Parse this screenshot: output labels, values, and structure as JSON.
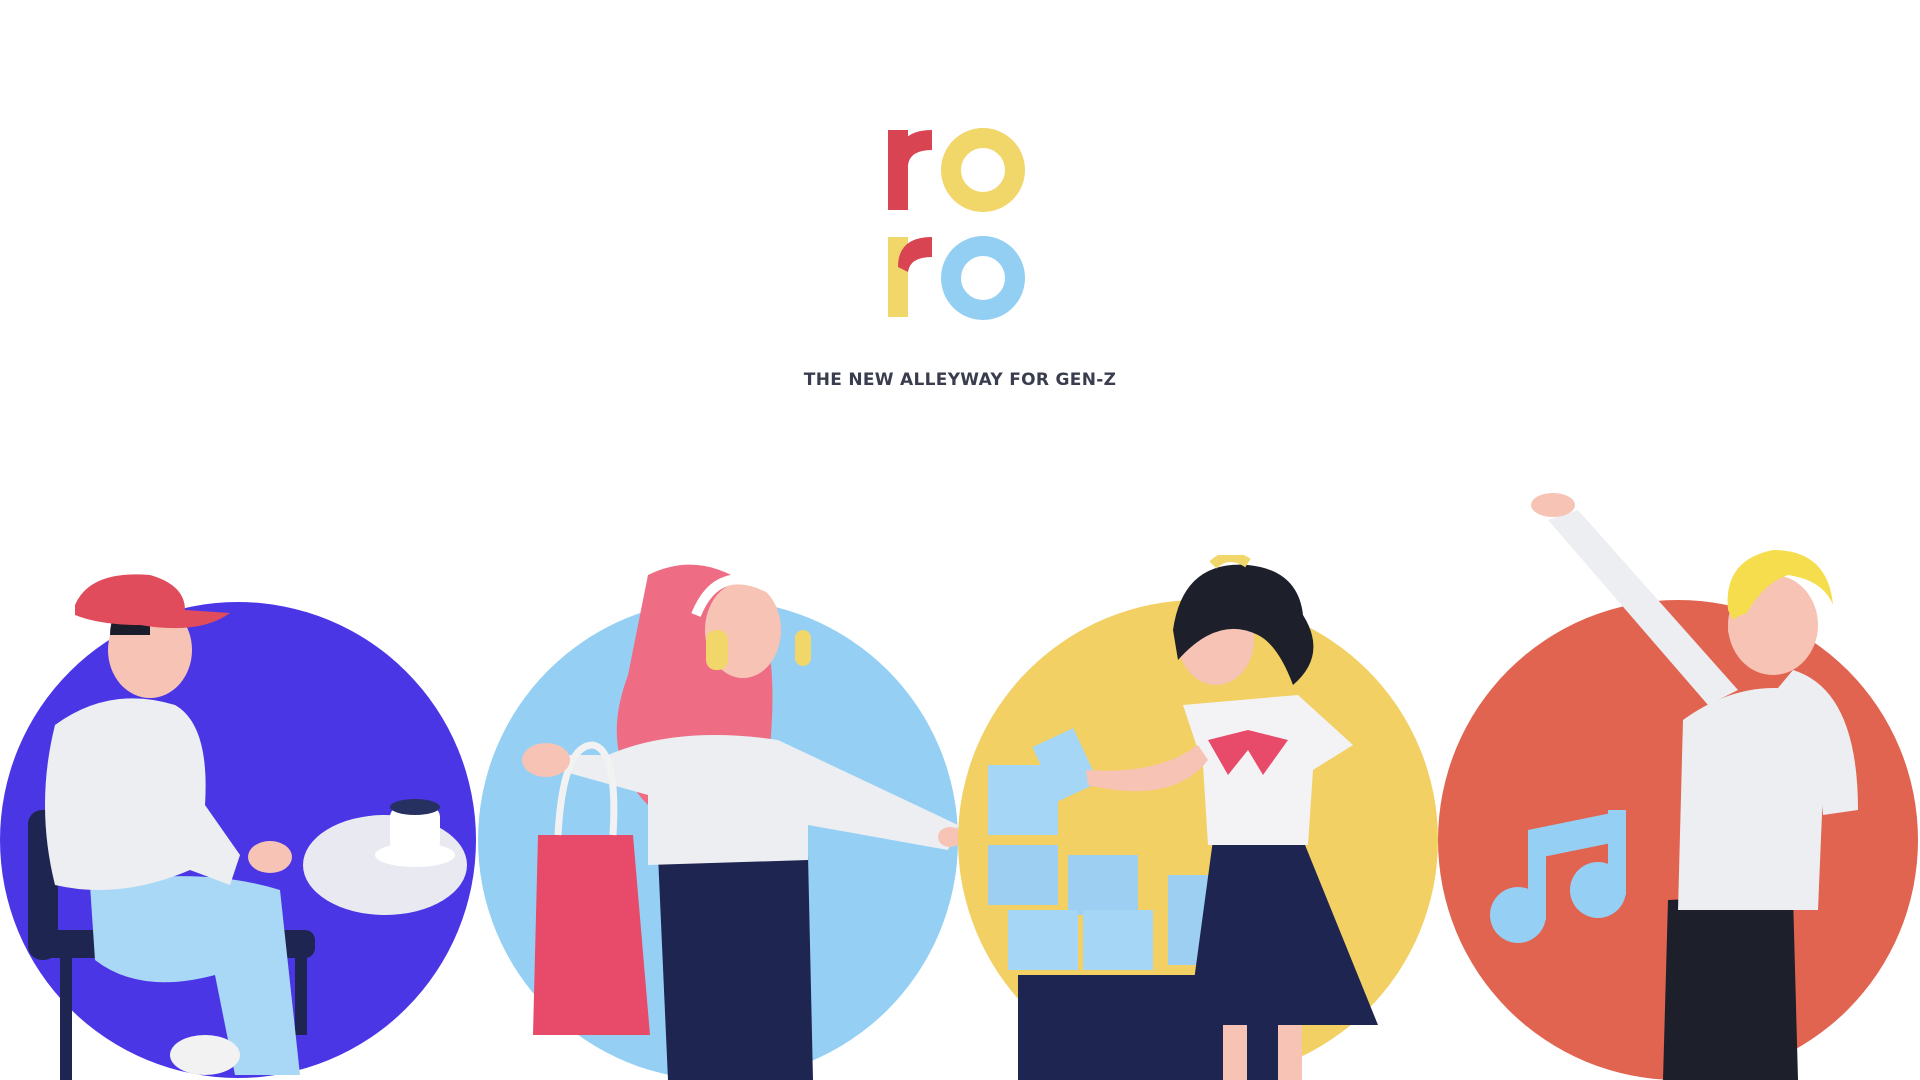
{
  "brand": {
    "letters": [
      "r",
      "o",
      "r",
      "o"
    ],
    "colors": {
      "r1": "#d84452",
      "o1": "#f1d66a",
      "r2_stem": "#f1d66a",
      "r2_arm": "#d84452",
      "o2": "#93cff3"
    }
  },
  "tagline": "THE NEW ALLEYWAY FOR GEN-Z",
  "scenes": [
    {
      "name": "cafe",
      "bg": "#4b36e6",
      "depicts": "boy-with-red-cap-sitting-at-coffee-table"
    },
    {
      "name": "shopping",
      "bg": "#95d0f4",
      "depicts": "girl-with-headphones-and-shopping-bag"
    },
    {
      "name": "boxes",
      "bg": "#f2d063",
      "depicts": "girl-with-ribbon-stacking-blue-boxes"
    },
    {
      "name": "music",
      "bg": "#e06450",
      "depicts": "boy-dabbing-with-music-note"
    }
  ]
}
